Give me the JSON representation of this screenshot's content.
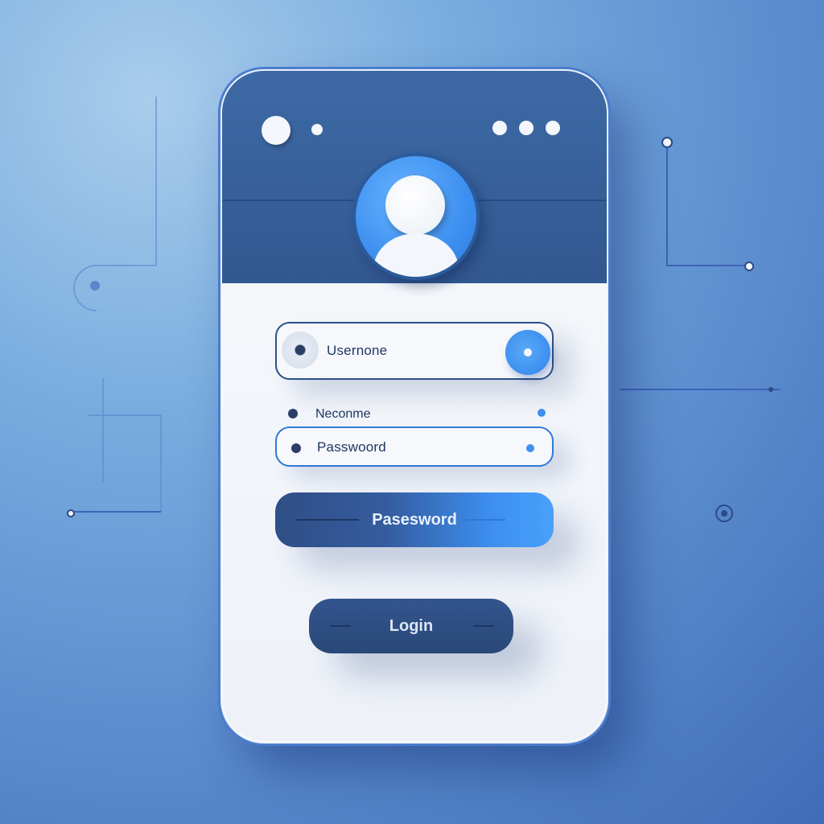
{
  "theme": {
    "accent": "#3d8ff0",
    "header": "#3d6aa6",
    "dark": "#2c3e66",
    "background": "#5d8fd0"
  },
  "header": {
    "avatar_icon": "user-avatar-icon"
  },
  "form": {
    "username_field": {
      "value": "Usernone",
      "icon": "radio-icon",
      "action_icon": "circle-toggle-icon"
    },
    "nickname_label": {
      "text": "Neconme"
    },
    "password_field": {
      "value": "Passwoord",
      "icon": "bullet-icon"
    },
    "password_button": {
      "label": "Pasesword"
    },
    "login_button": {
      "label": "Login"
    }
  }
}
